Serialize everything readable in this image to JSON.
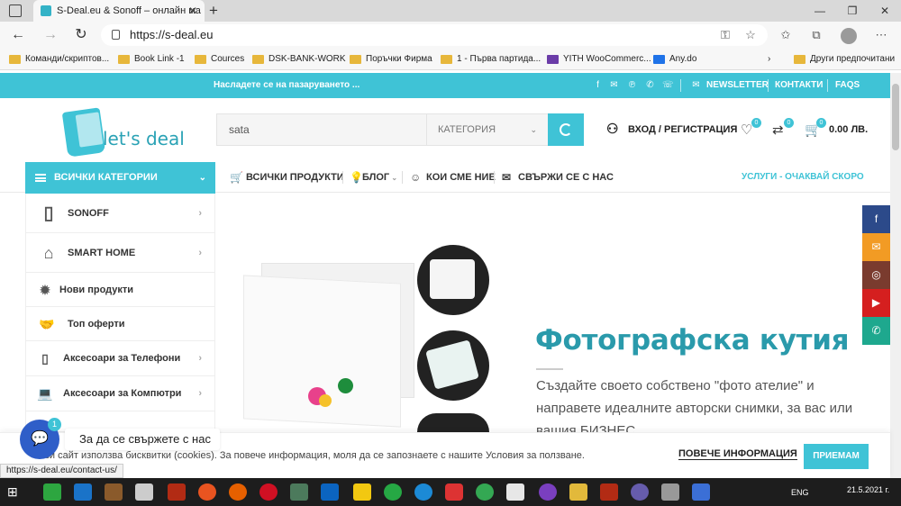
{
  "browser": {
    "tab_title": "S-Deal.eu & Sonoff – онлайн ма",
    "url": "https://s-deal.eu",
    "bookmarks": [
      "Команди/скриптов...",
      "Book Link -1",
      "Cources",
      "DSK-BANK-WORK",
      "Поръчки Фирма",
      "1 - Първа партида...",
      "YITH WooCommerc...",
      "Any.do"
    ],
    "bookmarks_overflow": "Други предпочитани"
  },
  "topbar": {
    "promo": "Насладете се на пазаруването ...",
    "newsletter": "NEWSLETTER",
    "contacts": "КОНТАКТИ",
    "faqs": "FAQS"
  },
  "header": {
    "logo_text": "let's deal",
    "search_value": "sata",
    "category_select": "КАТЕГОРИЯ",
    "login": "ВХОД / РЕГИСТРАЦИЯ",
    "wishlist_count": "0",
    "compare_count": "0",
    "cart_count": "0",
    "cart_total": "0.00 ЛВ."
  },
  "nav": {
    "all_categories": "ВСИЧКИ КАТЕГОРИИ",
    "items": [
      "ВСИЧКИ ПРОДУКТИ",
      "БЛОГ",
      "КОИ СМЕ НИЕ",
      "СВЪРЖИ СЕ С НАС"
    ],
    "services": "УСЛУГИ - ОЧАКВАЙ СКОРО"
  },
  "sidebar": {
    "items": [
      "SONOFF",
      "SMART HOME",
      "Нови продукти",
      "Топ оферти",
      "Аксесоари за Телефони",
      "Аксесоари за Компютри"
    ]
  },
  "hero": {
    "title": "Фотографска кутия",
    "text": "Създайте своето собствено \"фото ателие\" и направете идеалните авторски снимки, за вас или вашия БИЗНЕС."
  },
  "cookie": {
    "message": "Този сайт използва бисквитки (cookies). За повече информация, моля да се запознаете с нашите Условия за ползване.",
    "more": "ПОВЕЧЕ ИНФОРМАЦИЯ",
    "accept": "ПРИЕМАМ"
  },
  "chat": {
    "label": "За да се свържете с нас",
    "badge": "1"
  },
  "status_url": "https://s-deal.eu/contact-us/",
  "system": {
    "lang": "ENG",
    "date": "21.5.2021 г."
  },
  "colors": {
    "accent": "#3fc3d6",
    "title": "#2a9aab"
  },
  "social_right": [
    "facebook-icon",
    "email-icon",
    "instagram-icon",
    "youtube-icon",
    "whatsapp-icon"
  ]
}
